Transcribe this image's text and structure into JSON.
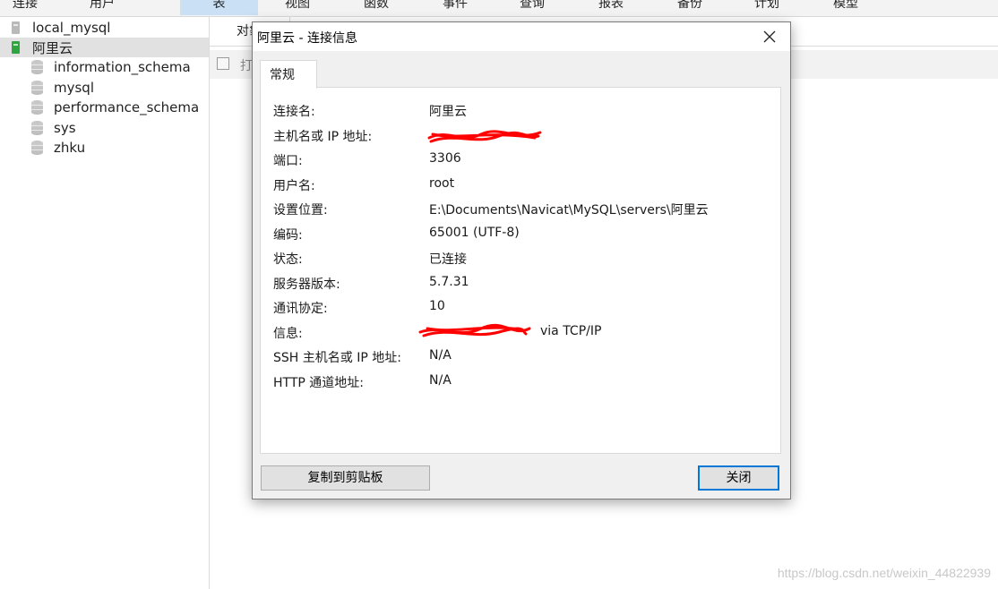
{
  "toolbar": {
    "items": [
      "连接",
      "用户",
      "表",
      "视图",
      "函数",
      "事件",
      "查询",
      "报表",
      "备份",
      "计划",
      "模型"
    ],
    "active_index": 2
  },
  "tree": {
    "connections": [
      {
        "label": "local_mysql",
        "status": "disconnected",
        "icon": "connection-icon"
      },
      {
        "label": "阿里云",
        "status": "connected",
        "icon": "connection-icon"
      }
    ],
    "databases": [
      "information_schema",
      "mysql",
      "performance_schema",
      "sys",
      "zhku"
    ]
  },
  "content": {
    "object_tab_label": "对象",
    "open_table_label": "打"
  },
  "dialog": {
    "title": "阿里云 - 连接信息",
    "tab_general": "常规",
    "rows": [
      {
        "label": "连接名:",
        "value": "阿里云"
      },
      {
        "label": "主机名或 IP 地址:",
        "value": ""
      },
      {
        "label": "端口:",
        "value": "3306"
      },
      {
        "label": "用户名:",
        "value": "root"
      },
      {
        "label": "设置位置:",
        "value": "E:\\Documents\\Navicat\\MySQL\\servers\\阿里云"
      },
      {
        "label": "编码:",
        "value": "65001 (UTF-8)"
      },
      {
        "label": "状态:",
        "value": "已连接"
      },
      {
        "label": "服务器版本:",
        "value": "5.7.31"
      },
      {
        "label": "通讯协定:",
        "value": "10"
      },
      {
        "label": "信息:",
        "value": "via TCP/IP"
      },
      {
        "label": "SSH 主机名或 IP 地址:",
        "value": "N/A"
      },
      {
        "label": "HTTP 通道地址:",
        "value": "N/A"
      }
    ],
    "copy_button": "复制到剪贴板",
    "close_button": "关闭"
  },
  "watermark": "https://blog.csdn.net/weixin_44822939",
  "colors": {
    "accent": "#0078d7",
    "selected_row": "#e1e1e1",
    "active_tab": "#c9e0f5",
    "connected_icon": "#2fa43f",
    "redaction": "#ff0000"
  }
}
